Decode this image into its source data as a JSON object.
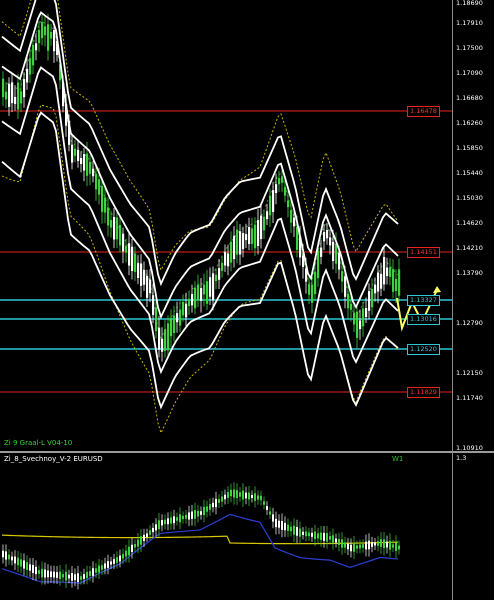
{
  "price_axis": {
    "ticks": [
      "1.18690",
      "1.17910",
      "1.17500",
      "1.17090",
      "1.16680",
      "1.16260",
      "1.15850",
      "1.15440",
      "1.15030",
      "1.14620",
      "1.14210",
      "1.13790",
      "1.12790",
      "1.12150",
      "1.11740",
      "1.10910"
    ]
  },
  "levels": [
    {
      "label": "1.16478",
      "color": "#e8231a"
    },
    {
      "label": "1.14151",
      "color": "#e8231a"
    },
    {
      "label": "1.13327",
      "color": "#2ec7d6"
    },
    {
      "label": "1.13016",
      "color": "#2ec7d6"
    },
    {
      "label": "1.12520",
      "color": "#2ec7d6"
    },
    {
      "label": "1.11829",
      "color": "#e8231a"
    }
  ],
  "main_indicator_label": "Zi 9 Graal-L V04-10",
  "sub_indicator_label": "Zi_8_Svechnoy_V-2 EURUSD",
  "timeframe_label": "W1",
  "sub_axis_top": "1.3",
  "colors": {
    "bull_candle": "#3fd13f",
    "bear_candle": "#ffffff",
    "bands": "#ffffff",
    "dotted_upper": "#c8b400",
    "dotted_green": "#2f8f2f",
    "moving_avg_yellow": "#d8c800",
    "moving_avg_blue": "#2a3fd0",
    "forecast": "#ffff66"
  }
}
